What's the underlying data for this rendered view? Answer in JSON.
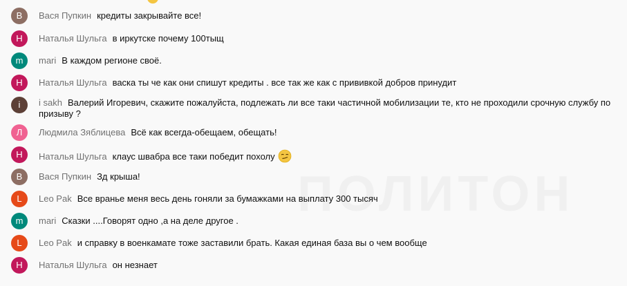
{
  "colors": {
    "background": "#f9f9f9",
    "author": "#717171",
    "text": "#0f0f0f",
    "brown": "#8d6e63",
    "magenta": "#c2185b",
    "teal": "#00897b",
    "pink": "#f06292",
    "deep_orange": "#e64a19",
    "dark_brown": "#5d4037"
  },
  "messages": [
    {
      "avatar": "В",
      "avatar_color": "#8d6e63",
      "author": "Вася Пупкин",
      "text": "кредиты закрывайте все!"
    },
    {
      "avatar": "Н",
      "avatar_color": "#c2185b",
      "author": "Наталья Шульга",
      "text": "в иркутске почему 100тыщ"
    },
    {
      "avatar": "m",
      "avatar_color": "#00897b",
      "author": "mari",
      "text": "В каждом регионе своё."
    },
    {
      "avatar": "Н",
      "avatar_color": "#c2185b",
      "author": "Наталья Шульга",
      "text": "васка ты че как они спишут кредиты . все так же как с прививкой добров принудит"
    },
    {
      "avatar": "i",
      "avatar_color": "#5d4037",
      "author": "i sakh",
      "text": "Валерий Игоревич, скажите пожалуйста, подлежать ли все таки частичной мобилизации те, кто не проходили срочную службу по призыву ?"
    },
    {
      "avatar": "Л",
      "avatar_color": "#f06292",
      "author": "Людмила Зяблицева",
      "text": "Всё как всегда-обещаем, обещать!"
    },
    {
      "avatar": "Н",
      "avatar_color": "#c2185b",
      "author": "Наталья Шульга",
      "text": "клаус швабра все таки победит похолу",
      "emoji": "smirk-emoji"
    },
    {
      "avatar": "В",
      "avatar_color": "#8d6e63",
      "author": "Вася Пупкин",
      "text": "Зд крыша!"
    },
    {
      "avatar": "L",
      "avatar_color": "#e64a19",
      "author": "Leo Pak",
      "text": "Все вранье меня весь день гоняли за бумажками на выплату 300 тысяч"
    },
    {
      "avatar": "m",
      "avatar_color": "#00897b",
      "author": "mari",
      "text": "Сказки ....Говорят одно ,а на деле другое ."
    },
    {
      "avatar": "L",
      "avatar_color": "#e64a19",
      "author": "Leo Pak",
      "text": "и справку в военкамате тоже заставили брать. Какая единая база вы о чем вообще"
    },
    {
      "avatar": "Н",
      "avatar_color": "#c2185b",
      "author": "Наталья Шульга",
      "text": "он незнает"
    }
  ]
}
